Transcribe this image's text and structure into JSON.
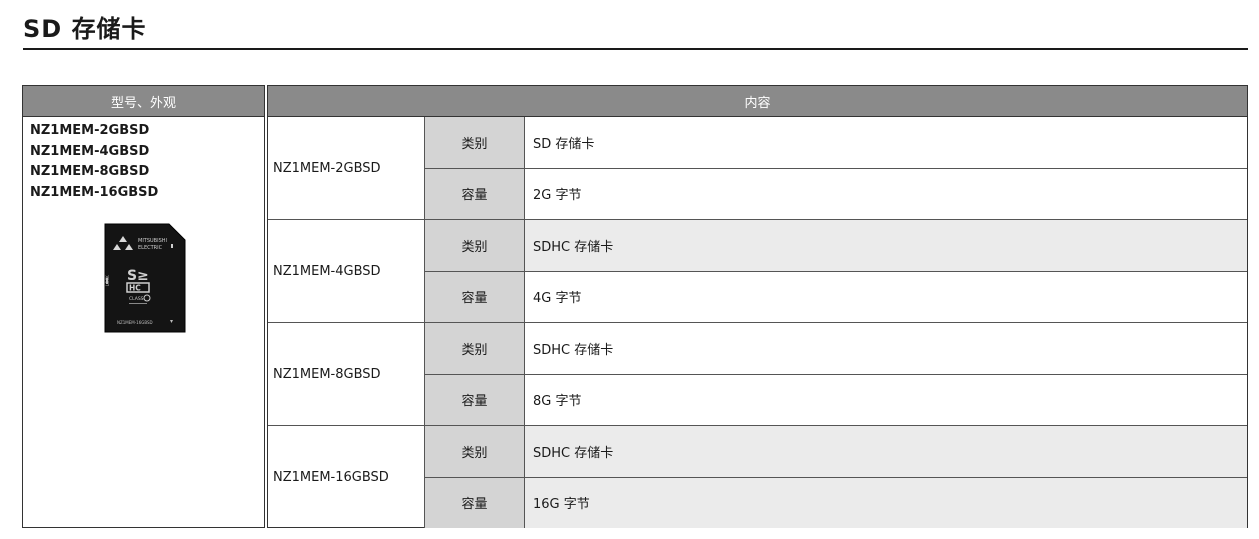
{
  "page": {
    "title": "SD 存储卡"
  },
  "left": {
    "header": "型号、外观",
    "models": [
      "NZ1MEM-2GBSD",
      "NZ1MEM-4GBSD",
      "NZ1MEM-8GBSD",
      "NZ1MEM-16GBSD"
    ],
    "card_image": {
      "brand": "MITSUBISHI",
      "brand2": "ELECTRIC",
      "class_text": "CLASS",
      "model_text": "NZ1MEM-16GBSD",
      "lock_text": "LOCK"
    }
  },
  "table": {
    "header": "内容",
    "groups": [
      {
        "model": "NZ1MEM-2GBSD",
        "rows": [
          {
            "label": "类别",
            "value": "SD 存储卡"
          },
          {
            "label": "容量",
            "value": "2G 字节"
          }
        ]
      },
      {
        "model": "NZ1MEM-4GBSD",
        "rows": [
          {
            "label": "类别",
            "value": "SDHC 存储卡"
          },
          {
            "label": "容量",
            "value": "4G 字节"
          }
        ]
      },
      {
        "model": "NZ1MEM-8GBSD",
        "rows": [
          {
            "label": "类别",
            "value": "SDHC 存储卡"
          },
          {
            "label": "容量",
            "value": "8G 字节"
          }
        ]
      },
      {
        "model": "NZ1MEM-16GBSD",
        "rows": [
          {
            "label": "类别",
            "value": "SDHC 存储卡"
          },
          {
            "label": "容量",
            "value": "16G 字节"
          }
        ]
      }
    ]
  }
}
